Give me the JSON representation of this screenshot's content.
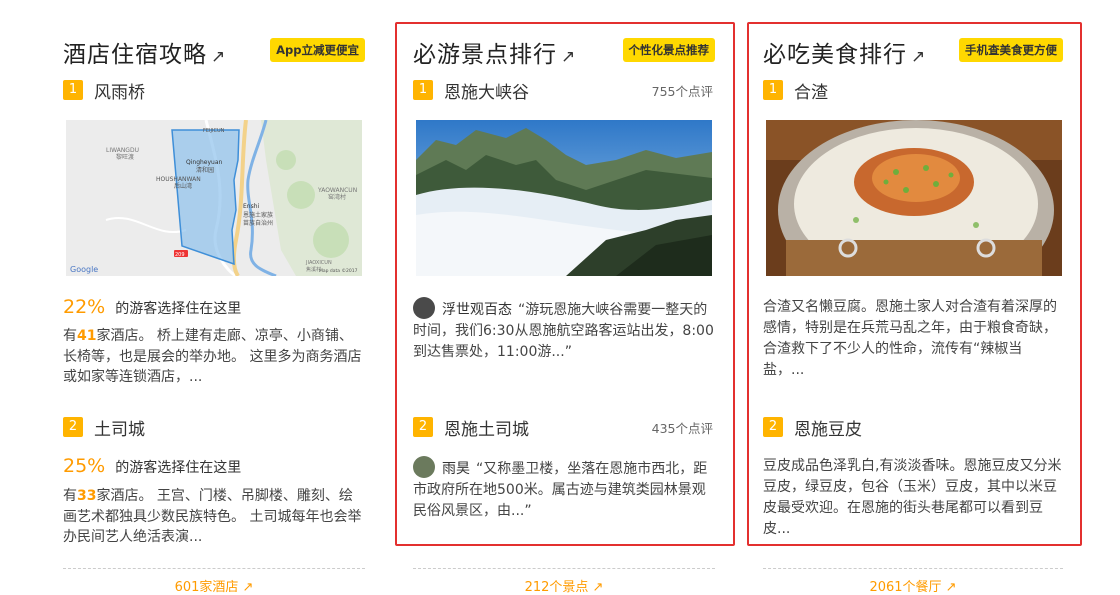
{
  "hotel": {
    "title": "酒店住宿攻略",
    "arrow": "↗",
    "badge": "App立减更便宜",
    "items": [
      {
        "rank": "1",
        "name": "风雨桥",
        "pct": "22%",
        "pct_text": "的游客选择住在这里",
        "desc_pre": "有",
        "count": "41",
        "desc_post": "家酒店。 桥上建有走廊、凉亭、小商铺、长椅等，也是展会的举办地。 这里多为商务酒店或如家等连锁酒店，..."
      },
      {
        "rank": "2",
        "name": "土司城",
        "pct": "25%",
        "pct_text": "的游客选择住在这里",
        "desc_pre": "有",
        "count": "33",
        "desc_post": "家酒店。 王宫、门楼、吊脚楼、雕刻、绘画艺术都独具少数民族特色。 土司城每年也会举办民间艺人绝活表演..."
      }
    ],
    "map": {
      "labels": [
        "LIWANGDU",
        "黎旺渡",
        "FEIJICUN",
        "Qingheyuan",
        "清和园",
        "HOUSHANWAN",
        "后山湾",
        "Enshi",
        "恩施土家族",
        "苗族自治州",
        "YAOWANCUN",
        "窑湾村",
        "JIAOXICUN",
        "焦溪村",
        "209",
        "Google",
        "Map data ©2017"
      ]
    },
    "more": "601家酒店 ↗"
  },
  "sight": {
    "title": "必游景点排行",
    "arrow": "↗",
    "badge": "个性化景点推荐",
    "items": [
      {
        "rank": "1",
        "name": "恩施大峡谷",
        "reviews": "755个点评",
        "reviewer": "浮世观百态",
        "quote": "“游玩恩施大峡谷需要一整天的时间，我们6:30从恩施航空路客运站出发，8:00到达售票处，11:00游...”"
      },
      {
        "rank": "2",
        "name": "恩施土司城",
        "reviews": "435个点评",
        "reviewer": "雨昊",
        "quote": "“又称墨卫楼，坐落在恩施市西北，距市政府所在地500米。属古迹与建筑类园林景观民俗风景区，由...”"
      }
    ],
    "more": "212个景点 ↗"
  },
  "food": {
    "title": "必吃美食排行",
    "arrow": "↗",
    "badge": "手机查美食更方便",
    "items": [
      {
        "rank": "1",
        "name": "合渣",
        "desc": "合渣又名懒豆腐。恩施土家人对合渣有着深厚的感情，特别是在兵荒马乱之年，由于粮食奇缺，合渣救下了不少人的性命，流传有“辣椒当盐，..."
      },
      {
        "rank": "2",
        "name": "恩施豆皮",
        "desc": "豆皮成品色泽乳白,有淡淡香味。恩施豆皮又分米豆皮，绿豆皮，包谷（玉米）豆皮，其中以米豆皮最受欢迎。在恩施的街头巷尾都可以看到豆皮..."
      }
    ],
    "more": "2061个餐厅 ↗"
  },
  "colors": {
    "accent": "#ff9b00",
    "badge": "#ffd800",
    "rank": "#ffb400",
    "highlight_border": "#e3302f"
  }
}
